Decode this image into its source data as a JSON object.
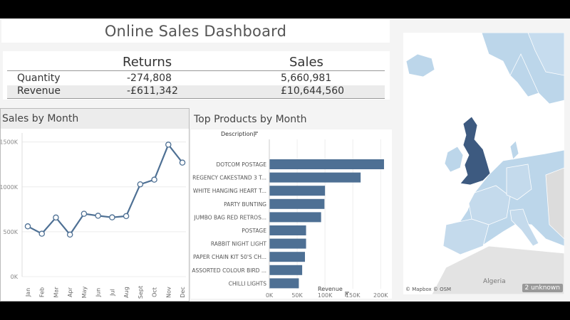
{
  "dashboard": {
    "title": "Online Sales Dashboard"
  },
  "kpi": {
    "columns": [
      "Returns",
      "Sales"
    ],
    "rows": [
      {
        "label": "Quantity",
        "returns": "-274,808",
        "sales": "5,660,981"
      },
      {
        "label": "Revenue",
        "returns": "-£611,342",
        "sales": "£10,644,560"
      }
    ]
  },
  "sales_by_month": {
    "title": "Sales by Month"
  },
  "top_products": {
    "title": "Top Products by Month",
    "dimension_label": "Description",
    "measure_label": "Revenue"
  },
  "map": {
    "attribution": "© Mapbox © OSM",
    "unknown_label": "2 unknown",
    "country_label": "Algeria"
  },
  "chart_data": [
    {
      "type": "line",
      "x": [
        "Jan",
        "Feb",
        "Mar",
        "Apr",
        "May",
        "Jun",
        "Jul",
        "Aug",
        "Sept",
        "Oct",
        "Nov",
        "Dec"
      ],
      "y": [
        560000,
        478000,
        658000,
        468000,
        700000,
        678000,
        660000,
        674000,
        1028000,
        1080000,
        1470000,
        1270000
      ],
      "ylim": [
        0,
        1600000
      ],
      "yticks": [
        "0K",
        "500K",
        "1000K",
        "1500K"
      ],
      "ytick_values": [
        0,
        500000,
        1000000,
        1500000
      ],
      "grid": true,
      "color": "#4e7094"
    },
    {
      "type": "bar",
      "orientation": "horizontal",
      "categories": [
        "DOTCOM POSTAGE",
        "REGENCY CAKESTAND 3 T...",
        "WHITE HANGING HEART T...",
        "PARTY BUNTING",
        "JUMBO BAG RED RETROS...",
        "POSTAGE",
        "RABBIT NIGHT LIGHT",
        "PAPER CHAIN KIT 50'S CH...",
        "ASSORTED COLOUR BIRD ...",
        "CHILLI LIGHTS"
      ],
      "values": [
        206000,
        164000,
        100000,
        99000,
        93000,
        66000,
        66000,
        64000,
        59000,
        53000
      ],
      "xlim": [
        0,
        215000
      ],
      "xticks": [
        "0K",
        "50K",
        "100K",
        "150K",
        "200K"
      ],
      "xtick_values": [
        0,
        50000,
        100000,
        150000,
        200000
      ],
      "grid": true,
      "color": "#4e7094"
    }
  ]
}
